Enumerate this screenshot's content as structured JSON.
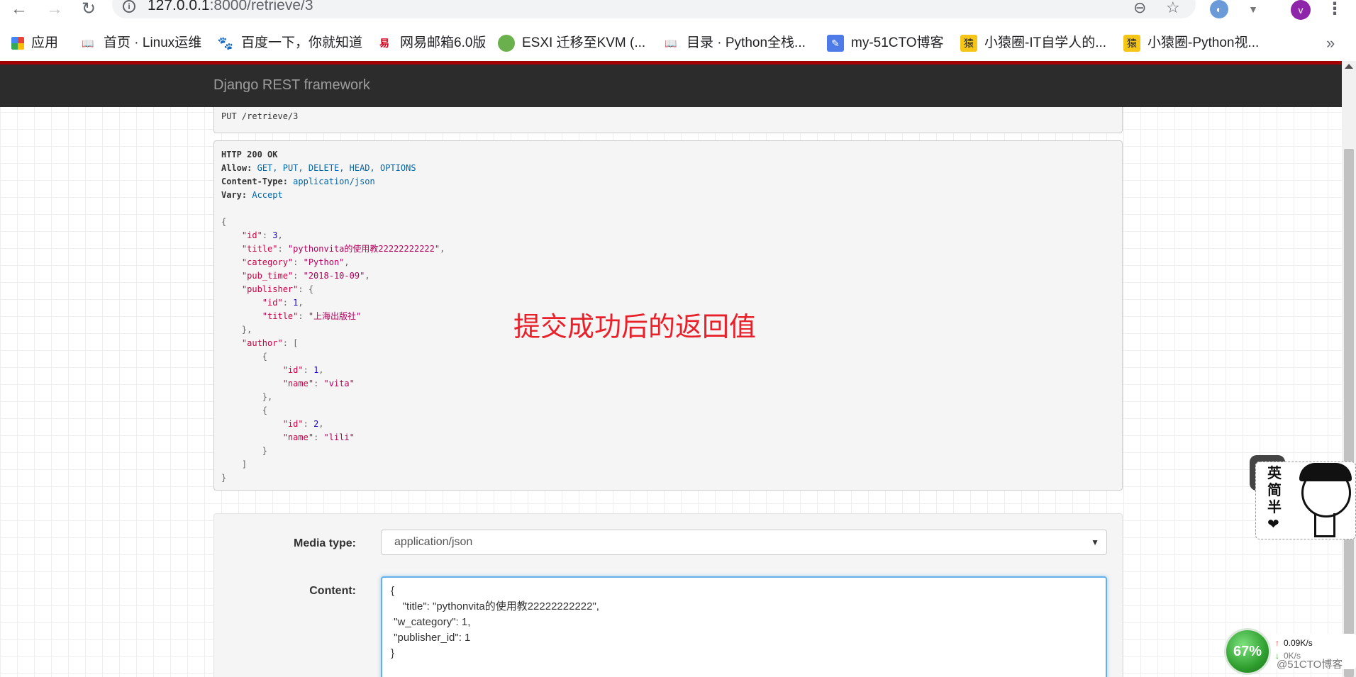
{
  "browser": {
    "url_host": "127.0.0.1",
    "url_rest": ":8000/retrieve/3",
    "profile_initial": "v",
    "icons": {
      "back": "back-arrow-icon",
      "forward": "forward-arrow-icon",
      "reload": "reload-icon",
      "info": "info-icon",
      "zoom": "zoom-out-icon",
      "star": "star-icon"
    }
  },
  "bookmarks": [
    {
      "label": "应用",
      "icon": "apps-grid-icon"
    },
    {
      "label": "首页 · Linux运维",
      "icon": "book-icon"
    },
    {
      "label": "百度一下，你就知道",
      "icon": "baidu-icon"
    },
    {
      "label": "网易邮箱6.0版",
      "icon": "netease-icon"
    },
    {
      "label": "ESXI 迁移至KVM (...",
      "icon": "frog-icon"
    },
    {
      "label": "目录 · Python全栈...",
      "icon": "book-icon"
    },
    {
      "label": "my-51CTO博客",
      "icon": "feather-icon"
    },
    {
      "label": "小猿圈-IT自学人的...",
      "icon": "ape-icon"
    },
    {
      "label": "小猿圈-Python视...",
      "icon": "ape-icon"
    }
  ],
  "page": {
    "brand": "Django REST framework",
    "request_line": "PUT /retrieve/3",
    "response": {
      "status": "HTTP 200 OK",
      "headers": [
        {
          "key": "Allow:",
          "value": "GET, PUT, DELETE, HEAD, OPTIONS"
        },
        {
          "key": "Content-Type:",
          "value": "application/json"
        },
        {
          "key": "Vary:",
          "value": "Accept"
        }
      ]
    },
    "annotation": "提交成功后的返回值",
    "form": {
      "media_type_label": "Media type:",
      "media_type_value": "application/json",
      "content_label": "Content:",
      "content_text": "{\n    \"title\": \"pythonvita的使用教22222222222\",\n \"w_category\": 1,\n \"publisher_id\": 1\n}"
    }
  },
  "widgets": {
    "sticker_text": "英简半❤",
    "net_percent": "67%",
    "net_up": "0.09K/s",
    "net_down": "0K/s",
    "watermark": "@51CTO博客"
  }
}
